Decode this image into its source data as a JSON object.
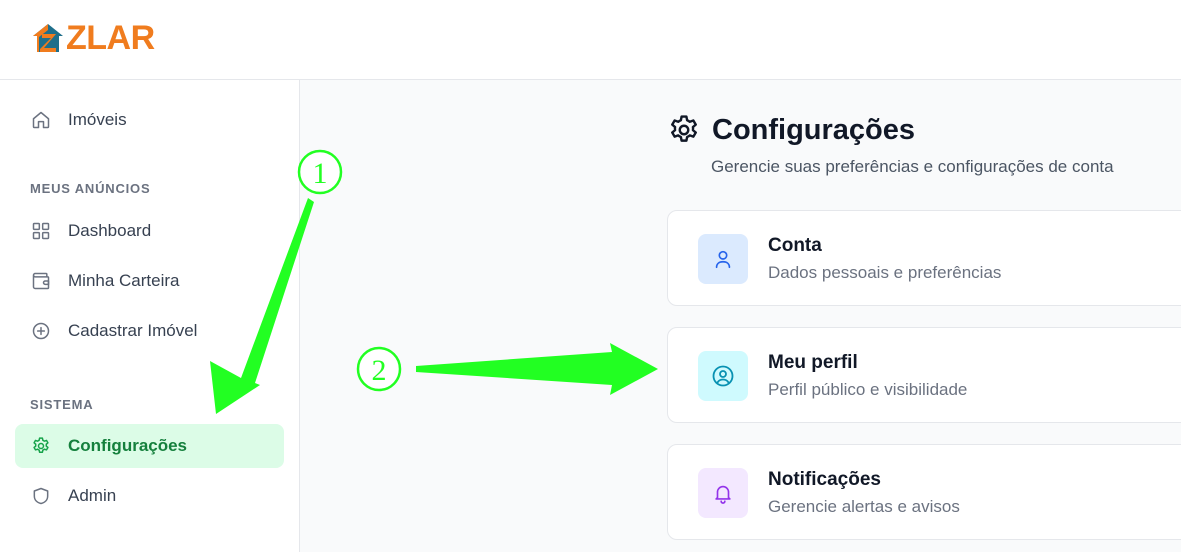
{
  "brand": {
    "logo_text": "ZLAR"
  },
  "sidebar": {
    "items_top": [
      {
        "label": "Imóveis",
        "icon": "home-icon"
      }
    ],
    "section_anuncios": "MEUS ANÚNCIOS",
    "items_anuncios": [
      {
        "label": "Dashboard",
        "icon": "grid-icon"
      },
      {
        "label": "Minha Carteira",
        "icon": "wallet-icon"
      },
      {
        "label": "Cadastrar Imóvel",
        "icon": "plus-circle-icon"
      }
    ],
    "section_sistema": "SISTEMA",
    "items_sistema": [
      {
        "label": "Configurações",
        "icon": "gear-icon",
        "active": true
      },
      {
        "label": "Admin",
        "icon": "shield-icon"
      }
    ]
  },
  "main": {
    "title": "Configurações",
    "subtitle": "Gerencie suas preferências e configurações de conta",
    "cards": [
      {
        "title": "Conta",
        "description": "Dados pessoais e preferências",
        "icon": "user-icon",
        "accent": "#2563eb",
        "badge_bg": "#dbeafe"
      },
      {
        "title": "Meu perfil",
        "description": "Perfil público e visibilidade",
        "icon": "user-circle-icon",
        "accent": "#0891b2",
        "badge_bg": "#cffafe"
      },
      {
        "title": "Notificações",
        "description": "Gerencie alertas e avisos",
        "icon": "bell-icon",
        "accent": "#9333ea",
        "badge_bg": "#f3e8ff"
      }
    ]
  },
  "annotations": {
    "step1": "1",
    "step2": "2",
    "color": "#22ff22"
  }
}
